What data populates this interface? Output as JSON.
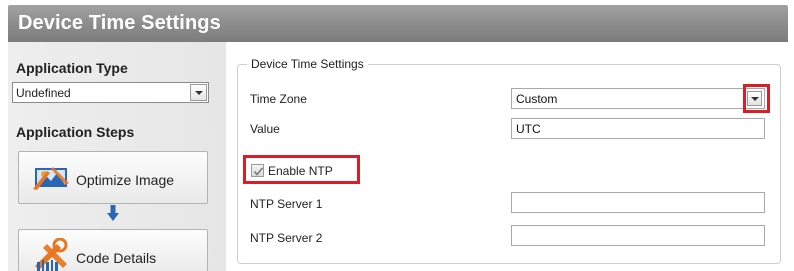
{
  "window": {
    "title": "Device Time Settings"
  },
  "left_panel": {
    "application_type": {
      "heading": "Application Type",
      "selected": "Undefined"
    },
    "application_steps": {
      "heading": "Application Steps",
      "steps": [
        {
          "label": "Optimize Image",
          "icon": "optimize-image-icon"
        },
        {
          "label": "Code Details",
          "icon": "code-details-icon"
        }
      ]
    }
  },
  "group": {
    "legend": "Device Time Settings",
    "fields": {
      "time_zone": {
        "label": "Time Zone",
        "value": "Custom"
      },
      "value": {
        "label": "Value",
        "value": "UTC"
      },
      "enable_ntp": {
        "label": "Enable NTP",
        "checked": true
      },
      "ntp_server_1": {
        "label": "NTP Server 1",
        "value": ""
      },
      "ntp_server_2": {
        "label": "NTP Server 2",
        "value": ""
      }
    }
  },
  "colors": {
    "title_bar": "#8f8f8f",
    "highlight": "#d91f26",
    "panel_bg": "#eeeeee",
    "step_arrow": "#2b66b3"
  }
}
